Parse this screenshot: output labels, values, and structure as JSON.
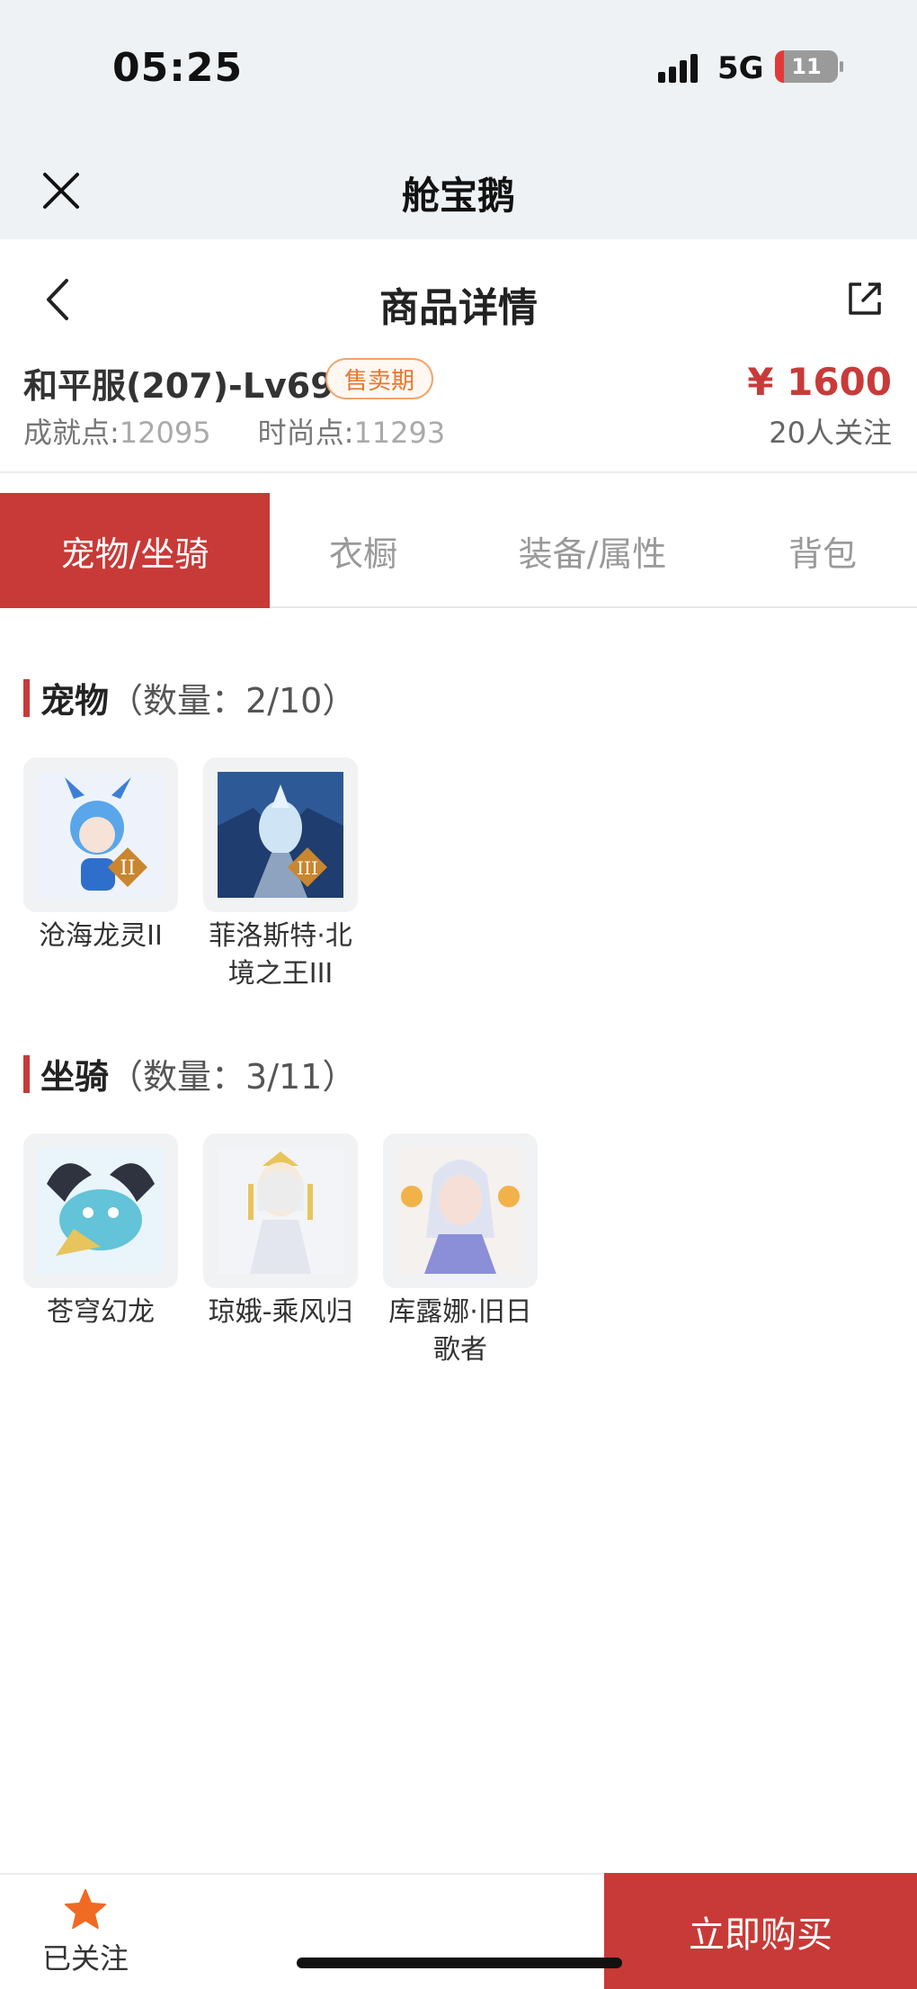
{
  "status_bar": {
    "time": "05:25",
    "network": "5G",
    "battery": "11"
  },
  "app": {
    "title": "舱宝鹅"
  },
  "header": {
    "title": "商品详情"
  },
  "product": {
    "server": "和平服(207)-Lv69",
    "badge": "售卖期",
    "achievement_label": "成就点:",
    "achievement_value": "12095",
    "fashion_label": "时尚点:",
    "fashion_value": "11293",
    "price": "¥ 1600",
    "followers": "20人关注"
  },
  "tabs": [
    "宠物/坐骑",
    "衣橱",
    "装备/属性",
    "背包"
  ],
  "pets": {
    "title": "宠物",
    "count": "（数量：2/10）",
    "items": [
      {
        "name": "沧海龙灵II"
      },
      {
        "name": "菲洛斯特·北境之王III"
      }
    ]
  },
  "mounts": {
    "title": "坐骑",
    "count": "（数量：3/11）",
    "items": [
      {
        "name": "苍穹幻龙"
      },
      {
        "name": "琼娥-乘风归"
      },
      {
        "name": "库露娜·旧日歌者"
      }
    ]
  },
  "bottom": {
    "follow_label": "已关注",
    "buy_label": "立即购买"
  },
  "colors": {
    "accent": "#c83a37",
    "badge": "#e8772d"
  }
}
